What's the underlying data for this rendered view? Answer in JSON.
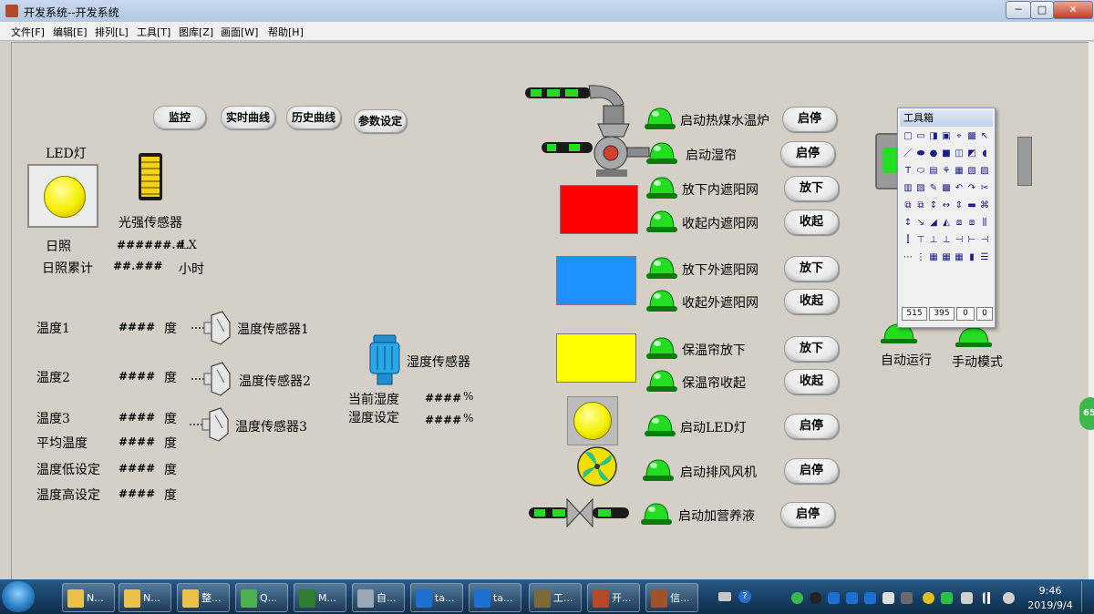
{
  "window": {
    "title": "开发系统--开发系统",
    "buttons": [
      "─",
      "□",
      "✕"
    ]
  },
  "menu": [
    "文件[F]",
    "编辑[E]",
    "排列[L]",
    "工具[T]",
    "图库[Z]",
    "画面[W]",
    "帮助[H]"
  ],
  "nav_buttons": [
    "监控",
    "实时曲线",
    "历史曲线",
    "参数设定"
  ],
  "left": {
    "led_label": "LED灯",
    "light_sensor_label": "光强传感器",
    "sunshine": {
      "label": "日照",
      "value": "######.#",
      "unit": "LX"
    },
    "sunshine_total": {
      "label": "日照累计",
      "value": "##.###",
      "unit": "小时"
    },
    "temps": [
      {
        "label": "温度1",
        "value": "####",
        "unit": "度",
        "sensor": "温度传感器1"
      },
      {
        "label": "温度2",
        "value": "####",
        "unit": "度",
        "sensor": "温度传感器2"
      },
      {
        "label": "温度3",
        "value": "####",
        "unit": "度",
        "sensor": "温度传感器3"
      }
    ],
    "avg_temp": {
      "label": "平均温度",
      "value": "####",
      "unit": "度"
    },
    "temp_low": {
      "label": "温度低设定",
      "value": "####",
      "unit": "度"
    },
    "temp_high": {
      "label": "温度高设定",
      "value": "####",
      "unit": "度"
    }
  },
  "humidity": {
    "sensor_label": "湿度传感器",
    "current": {
      "label": "当前湿度",
      "value": "####",
      "unit": "%"
    },
    "setpoint": {
      "label": "湿度设定",
      "value": "####",
      "unit": "%"
    }
  },
  "controls": [
    {
      "label": "启动热煤水温炉",
      "button": "启停"
    },
    {
      "label": "启动湿帘",
      "button": "启停"
    },
    {
      "label": "放下内遮阳网",
      "button": "放下"
    },
    {
      "label": "收起内遮阳网",
      "button": "收起"
    },
    {
      "label": "放下外遮阳网",
      "button": "放下"
    },
    {
      "label": "收起外遮阳网",
      "button": "收起"
    },
    {
      "label": "保温帘放下",
      "button": "放下"
    },
    {
      "label": "保温帘收起",
      "button": "收起"
    },
    {
      "label": "启动LED灯",
      "button": "启停"
    },
    {
      "label": "启动排风风机",
      "button": "启停"
    },
    {
      "label": "启动加营养液",
      "button": "启停"
    }
  ],
  "panels": {
    "inner_shade_color": "#ff0000",
    "outer_shade_color": "#1e90ff",
    "curtain_color": "#ffff00"
  },
  "modes": {
    "auto": "自动运行",
    "manual": "手动模式"
  },
  "toolbox": {
    "title": "工具箱",
    "coords": [
      "515",
      "395",
      "0",
      "0"
    ]
  },
  "side_badge": "65",
  "taskbar": {
    "items": [
      {
        "label": "N...",
        "icon": "folder-icon",
        "color": "#e8c04a"
      },
      {
        "label": "N...",
        "icon": "folder-icon",
        "color": "#e8c04a"
      },
      {
        "label": "整...",
        "icon": "folder-icon",
        "color": "#e8c04a"
      },
      {
        "label": "Q...",
        "icon": "browser-icon",
        "color": "#4caf50"
      },
      {
        "label": "M...",
        "icon": "excel-icon",
        "color": "#2e7d32"
      },
      {
        "label": "自...",
        "icon": "paint-icon",
        "color": "#9aa7b5"
      },
      {
        "label": "ta...",
        "icon": "app-u-icon",
        "color": "#1e6fd0"
      },
      {
        "label": "ta...",
        "icon": "app-u-icon",
        "color": "#1e6fd0"
      },
      {
        "label": "工...",
        "icon": "tools-icon",
        "color": "#7a6a3a"
      },
      {
        "label": "开...",
        "icon": "dev-icon",
        "color": "#b54a2a"
      },
      {
        "label": "信...",
        "icon": "book-icon",
        "color": "#a0522d"
      }
    ],
    "time": "9:46",
    "date": "2019/9/4"
  },
  "colors": {
    "lamp_green": "#22dd22",
    "canvas_bg": "#d4d0c8"
  }
}
